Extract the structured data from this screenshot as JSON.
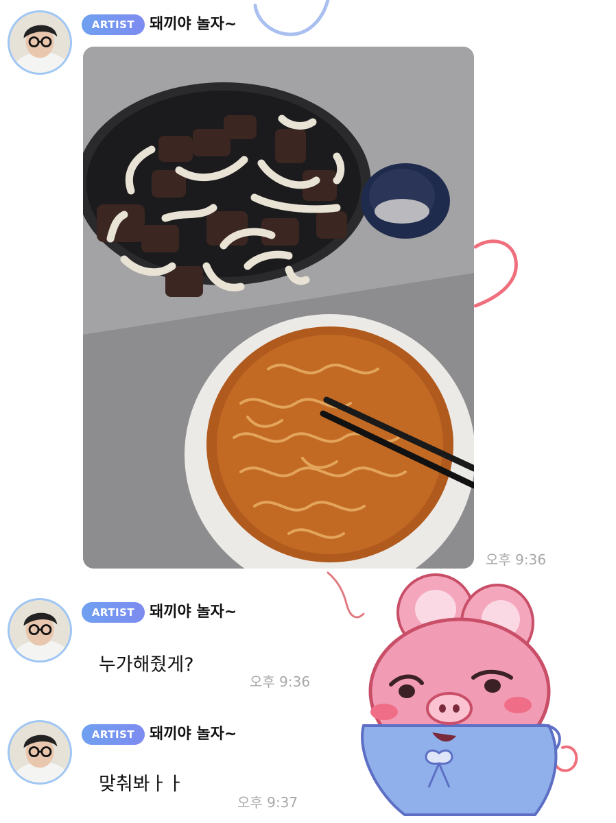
{
  "messages": [
    {
      "badge": "ARTIST",
      "name": "돼끼야 놀자~",
      "text": "",
      "time": "오후 9:36",
      "has_photo": true
    },
    {
      "badge": "ARTIST",
      "name": "돼끼야 놀자~",
      "text": "누가해줬게?",
      "time": "오후 9:36"
    },
    {
      "badge": "ARTIST",
      "name": "돼끼야 놀자~",
      "text": "맞춰봐ㅏㅏ",
      "time": "오후 9:37"
    }
  ],
  "colors": {
    "badge_gradient_start": "#6fa0f0",
    "badge_gradient_end": "#7d8bf0",
    "avatar_ring": "#9fc6f4",
    "timestamp": "#a8a8a8",
    "doodle_red": "#ef6f7d",
    "doodle_blue": "#9cb6ef"
  },
  "icons": {
    "avatar": "profile-avatar-glasses",
    "sticker": "pink-bunny-pig-sticker"
  }
}
